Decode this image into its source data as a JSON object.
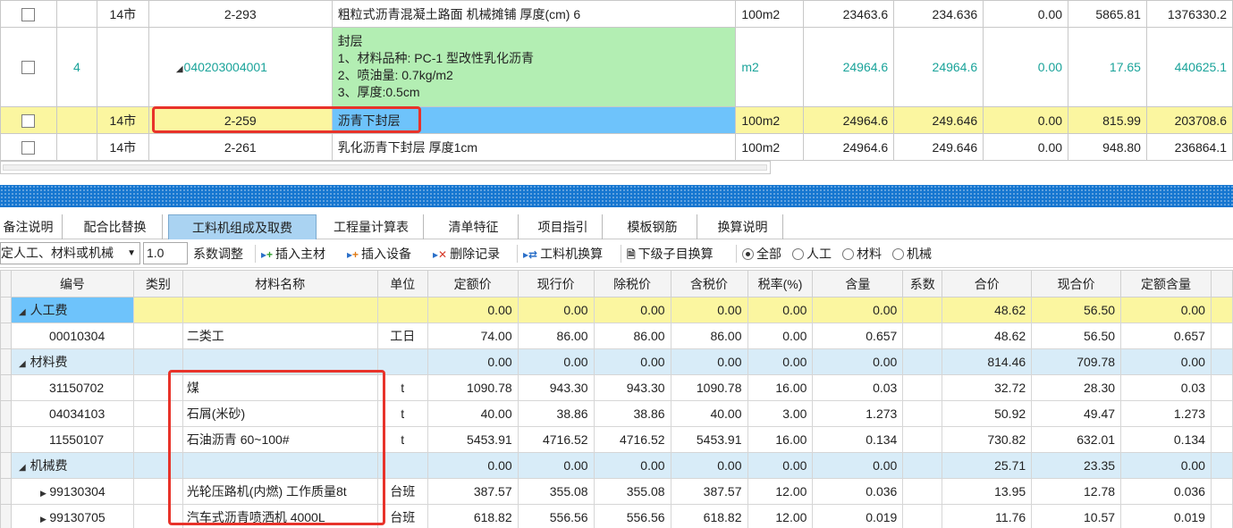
{
  "top_table": {
    "rows": [
      {
        "code": "14市",
        "item": "2-293",
        "name": "粗粒式沥青混凝土路面 机械摊铺 厚度(cm) 6",
        "unit": "100m2",
        "qty1": "23463.6",
        "qty2": "234.636",
        "v1": "0.00",
        "v2": "5865.81",
        "v3": "1376330.2"
      },
      {
        "no": "4",
        "item": "040203004001",
        "name_lines": [
          "封层",
          "1、材料品种: PC-1 型改性乳化沥青",
          "2、喷油量: 0.7kg/m2",
          "3、厚度:0.5cm"
        ],
        "unit": "m2",
        "qty1": "24964.6",
        "qty2": "24964.6",
        "v1": "0.00",
        "v2": "17.65",
        "v3": "440625.1"
      },
      {
        "code": "14市",
        "item": "2-259",
        "name": "沥青下封层",
        "unit": "100m2",
        "qty1": "24964.6",
        "qty2": "249.646",
        "v1": "0.00",
        "v2": "815.99",
        "v3": "203708.6"
      },
      {
        "code": "14市",
        "item": "2-261",
        "name": "乳化沥青下封层 厚度1cm",
        "unit": "100m2",
        "qty1": "24964.6",
        "qty2": "249.646",
        "v1": "0.00",
        "v2": "948.80",
        "v3": "236864.1"
      }
    ]
  },
  "tabs": [
    "备注说明",
    "配合比替换",
    "工料机组成及取费",
    "工程量计算表",
    "清单特征",
    "项目指引",
    "模板钢筋",
    "换算说明"
  ],
  "active_tab": "工料机组成及取费",
  "toolbar": {
    "select_value": "定人工、材料或机械",
    "coef_value": "1.0",
    "coef_label": "系数调整",
    "insert_main": "插入主材",
    "insert_equip": "插入设备",
    "delete_record": "删除记录",
    "swap": "工料机换算",
    "sub_swap": "下级子目换算",
    "radio_all": "全部",
    "radio_labor": "人工",
    "radio_material": "材料",
    "radio_machine": "机械"
  },
  "bottom_table": {
    "headers": [
      "编号",
      "类别",
      "材料名称",
      "单位",
      "定额价",
      "现行价",
      "除税价",
      "含税价",
      "税率(%)",
      "含量",
      "系数",
      "合价",
      "现合价",
      "定额含量"
    ],
    "rows": [
      {
        "group": true,
        "label": "人工费",
        "vals": [
          "0.00",
          "0.00",
          "0.00",
          "0.00",
          "0.00",
          "0.00",
          "",
          "48.62",
          "56.50",
          "0.00"
        ]
      },
      {
        "code": "00010304",
        "name": "二类工",
        "unit": "工日",
        "vals": [
          "74.00",
          "86.00",
          "86.00",
          "86.00",
          "0.00",
          "0.657",
          "",
          "48.62",
          "56.50",
          "0.657"
        ]
      },
      {
        "group": true,
        "label": "材料费",
        "vals": [
          "0.00",
          "0.00",
          "0.00",
          "0.00",
          "0.00",
          "0.00",
          "",
          "814.46",
          "709.78",
          "0.00"
        ]
      },
      {
        "code": "31150702",
        "name": "煤",
        "unit": "t",
        "vals": [
          "1090.78",
          "943.30",
          "943.30",
          "1090.78",
          "16.00",
          "0.03",
          "",
          "32.72",
          "28.30",
          "0.03"
        ]
      },
      {
        "code": "04034103",
        "name": "石屑(米砂)",
        "unit": "t",
        "vals": [
          "40.00",
          "38.86",
          "38.86",
          "40.00",
          "3.00",
          "1.273",
          "",
          "50.92",
          "49.47",
          "1.273"
        ]
      },
      {
        "code": "11550107",
        "name": "石油沥青  60~100#",
        "unit": "t",
        "vals": [
          "5453.91",
          "4716.52",
          "4716.52",
          "5453.91",
          "16.00",
          "0.134",
          "",
          "730.82",
          "632.01",
          "0.134"
        ]
      },
      {
        "group": true,
        "label": "机械费",
        "vals": [
          "0.00",
          "0.00",
          "0.00",
          "0.00",
          "0.00",
          "0.00",
          "",
          "25.71",
          "23.35",
          "0.00"
        ]
      },
      {
        "code": "99130304",
        "expand": true,
        "name": "光轮压路机(内燃) 工作质量8t",
        "unit": "台班",
        "vals": [
          "387.57",
          "355.08",
          "355.08",
          "387.57",
          "12.00",
          "0.036",
          "",
          "13.95",
          "12.78",
          "0.036"
        ]
      },
      {
        "code": "99130705",
        "expand": true,
        "name": "汽车式沥青喷洒机 4000L",
        "unit": "台班",
        "vals": [
          "618.82",
          "556.56",
          "556.56",
          "618.82",
          "12.00",
          "0.019",
          "",
          "11.76",
          "10.57",
          "0.019"
        ]
      }
    ]
  },
  "colors": {
    "accent": "#1576d0",
    "highlight": "#e8332a",
    "teal": "#1aa39a",
    "green_cell": "#b3eeb3",
    "yellow_row": "#fbf6a0",
    "blue_cell": "#6ec3fb"
  }
}
